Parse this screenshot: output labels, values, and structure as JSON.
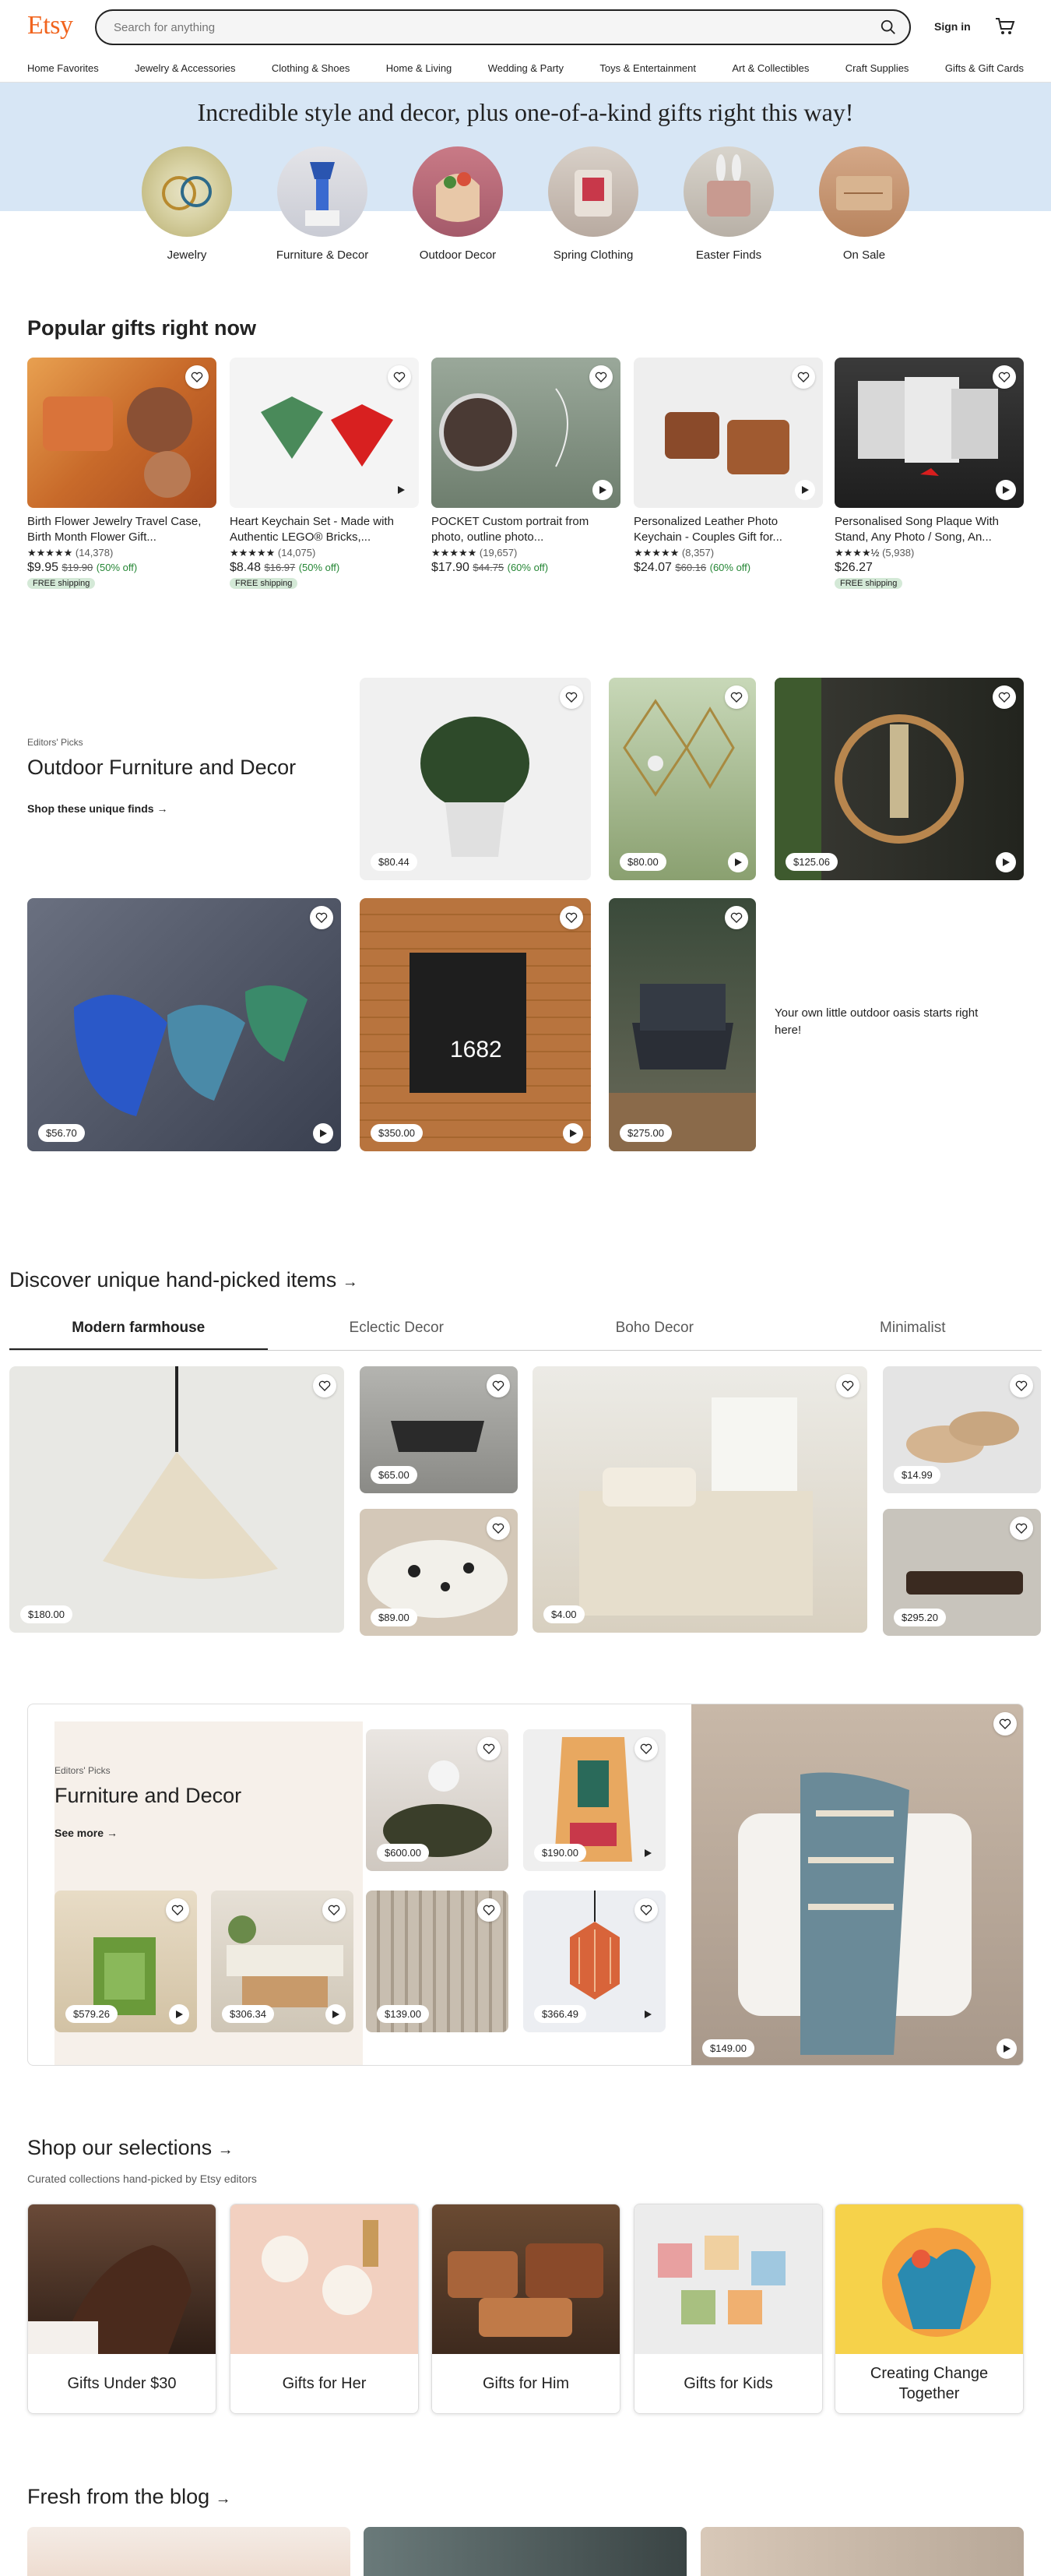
{
  "header": {
    "logo": "Etsy",
    "search_placeholder": "Search for anything",
    "signin": "Sign in"
  },
  "nav": [
    "Home Favorites",
    "Jewelry & Accessories",
    "Clothing & Shoes",
    "Home & Living",
    "Wedding & Party",
    "Toys & Entertainment",
    "Art & Collectibles",
    "Craft Supplies",
    "Gifts & Gift Cards"
  ],
  "hero": {
    "title": "Incredible style and decor, plus one-of-a-kind gifts right this way!",
    "categories": [
      {
        "label": "Jewelry"
      },
      {
        "label": "Furniture & Decor"
      },
      {
        "label": "Outdoor Decor"
      },
      {
        "label": "Spring Clothing"
      },
      {
        "label": "Easter Finds"
      },
      {
        "label": "On Sale"
      }
    ]
  },
  "popular": {
    "title": "Popular gifts right now",
    "items": [
      {
        "title": "Birth Flower Jewelry Travel Case, Birth Month Flower Gift...",
        "rating": "★★★★★",
        "reviews": "(14,378)",
        "price": "$9.95",
        "original": "$19.90",
        "discount": "(50% off)",
        "badge": "FREE shipping"
      },
      {
        "title": "Heart Keychain Set - Made with Authentic LEGO® Bricks,...",
        "rating": "★★★★★",
        "reviews": "(14,075)",
        "price": "$8.48",
        "original": "$16.97",
        "discount": "(50% off)",
        "badge": "FREE shipping"
      },
      {
        "title": "POCKET Custom portrait from photo, outline photo...",
        "rating": "★★★★★",
        "reviews": "(19,657)",
        "price": "$17.90",
        "original": "$44.75",
        "discount": "(60% off)",
        "badge": ""
      },
      {
        "title": "Personalized Leather Photo Keychain - Couples Gift for...",
        "rating": "★★★★★",
        "reviews": "(8,357)",
        "price": "$24.07",
        "original": "$60.16",
        "discount": "(60% off)",
        "badge": ""
      },
      {
        "title": "Personalised Song Plaque With Stand, Any Photo / Song, An...",
        "rating": "★★★★½",
        "reviews": "(5,938)",
        "price": "$26.27",
        "original": "",
        "discount": "",
        "badge": "FREE shipping"
      }
    ]
  },
  "outdoor": {
    "eyebrow": "Editors' Picks",
    "title": "Outdoor Furniture and Decor",
    "link": "Shop these unique finds",
    "tagline": "Your own little outdoor oasis starts right here!",
    "prices": [
      "$80.44",
      "$80.00",
      "$125.06",
      "$56.70",
      "$350.00",
      "$275.00"
    ],
    "house_number": "1682"
  },
  "discover": {
    "title": "Discover unique hand-picked items",
    "tabs": [
      "Modern farmhouse",
      "Eclectic Decor",
      "Boho Decor",
      "Minimalist"
    ],
    "prices": [
      "$180.00",
      "$65.00",
      "$89.00",
      "$4.00",
      "$14.99",
      "$295.20"
    ]
  },
  "furniture": {
    "eyebrow": "Editors' Picks",
    "title": "Furniture and Decor",
    "link": "See more",
    "prices": [
      "$600.00",
      "$190.00",
      "$579.26",
      "$306.34",
      "$139.00",
      "$366.49",
      "$149.00"
    ]
  },
  "selections": {
    "title": "Shop our selections",
    "subtitle": "Curated collections hand-picked by Etsy editors",
    "items": [
      "Gifts Under $30",
      "Gifts for Her",
      "Gifts for Him",
      "Gifts for Kids",
      "Creating Change Together"
    ]
  },
  "blog": {
    "title": "Fresh from the blog"
  },
  "colors": {
    "brand": "#F1641E",
    "hero_bg": "#D7E6F5",
    "discount_green": "#258635",
    "free_ship_bg": "#D4E9D7"
  }
}
